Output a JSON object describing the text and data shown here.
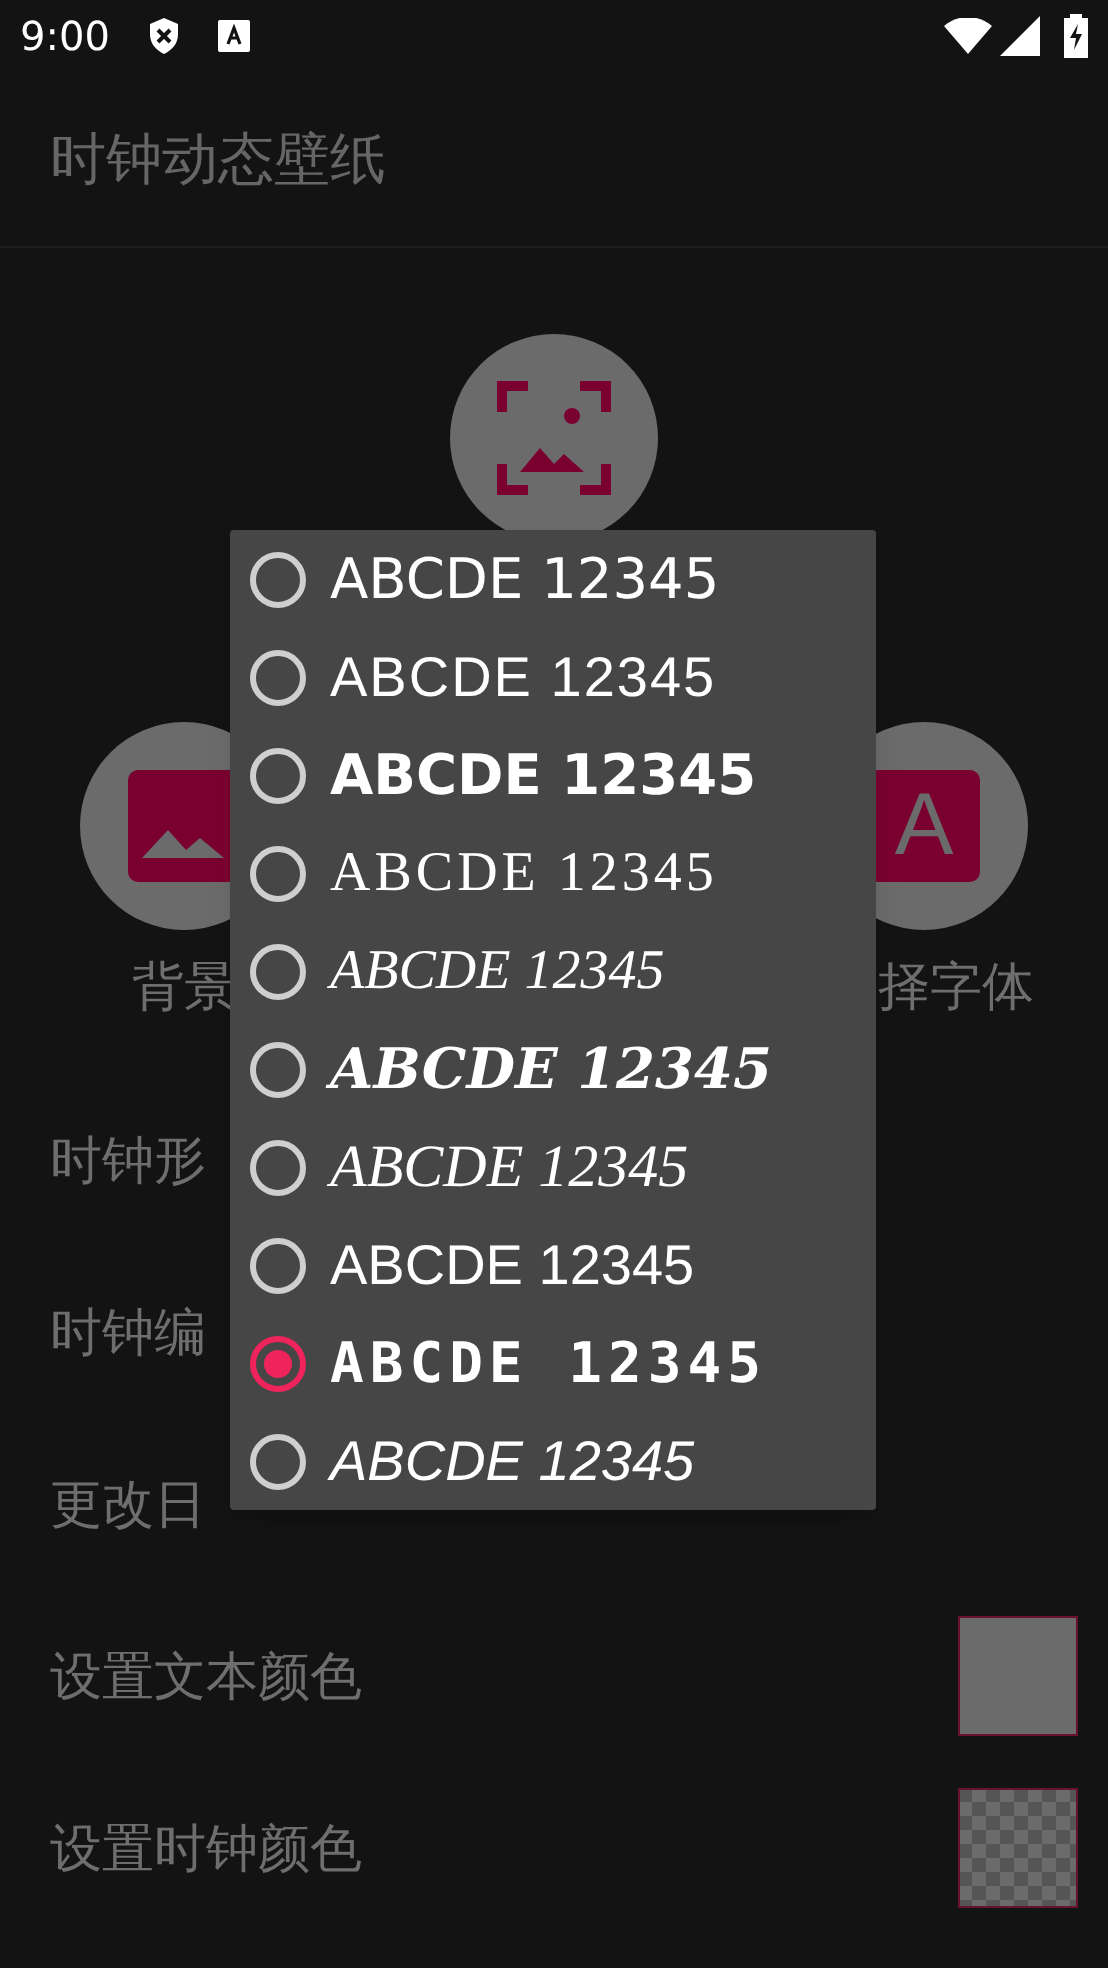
{
  "status_bar": {
    "time": "9:00"
  },
  "app_bar": {
    "title": "时钟动态壁纸"
  },
  "actions": [
    {
      "kind": "frame"
    },
    {
      "kind": "image",
      "label": "背景"
    },
    {
      "kind": "font",
      "glyph": "A",
      "label": "择字体"
    }
  ],
  "settings": [
    {
      "label": "时钟形",
      "kind": "plain"
    },
    {
      "label": "时钟编",
      "kind": "plain"
    },
    {
      "label": "更改日",
      "kind": "plain"
    },
    {
      "label": "设置文本颜色",
      "kind": "solid"
    },
    {
      "label": "设置时钟颜色",
      "kind": "transparent"
    }
  ],
  "font_dialog": {
    "options": [
      {
        "text": "ABCDE 12345",
        "kind": "regular",
        "selected": false
      },
      {
        "text": "ABCDE 12345",
        "kind": "thin",
        "selected": false
      },
      {
        "text": "ABCDE 12345",
        "kind": "bold",
        "selected": false
      },
      {
        "text": "ABCDE 12345",
        "kind": "serif",
        "selected": false
      },
      {
        "text": "ABCDE 12345",
        "kind": "hand",
        "selected": false
      },
      {
        "text": "ABCDE 12345",
        "kind": "brush",
        "selected": false
      },
      {
        "text": "ABCDE 12345",
        "kind": "script",
        "selected": false
      },
      {
        "text": "ABCDE 12345",
        "kind": "deco",
        "selected": false
      },
      {
        "text": "ABCDE 12345",
        "kind": "digital",
        "selected": true
      },
      {
        "text": "ABCDE 12345",
        "kind": "italic",
        "selected": false
      }
    ]
  }
}
